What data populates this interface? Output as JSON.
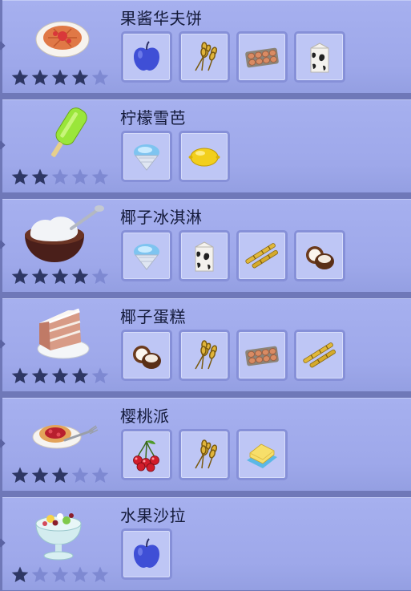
{
  "recipes": [
    {
      "name": "果酱华夫饼",
      "dish_icon": "jam-waffle-icon",
      "rating": 4,
      "max_rating": 5,
      "ingredients": [
        "apple",
        "wheat",
        "eggs",
        "milk"
      ]
    },
    {
      "name": "柠檬雪芭",
      "dish_icon": "lemon-sorbet-icon",
      "rating": 2,
      "max_rating": 5,
      "ingredients": [
        "ice",
        "lemon"
      ]
    },
    {
      "name": "椰子冰淇淋",
      "dish_icon": "coconut-ice-cream-icon",
      "rating": 4,
      "max_rating": 5,
      "ingredients": [
        "ice",
        "milk",
        "sugarcane",
        "coconut"
      ]
    },
    {
      "name": "椰子蛋糕",
      "dish_icon": "coconut-cake-icon",
      "rating": 4,
      "max_rating": 5,
      "ingredients": [
        "coconut",
        "wheat",
        "eggs",
        "sugarcane"
      ]
    },
    {
      "name": "樱桃派",
      "dish_icon": "cherry-pie-icon",
      "rating": 3,
      "max_rating": 5,
      "ingredients": [
        "cherry",
        "wheat",
        "butter"
      ]
    },
    {
      "name": "水果沙拉",
      "dish_icon": "fruit-salad-icon",
      "rating": 1,
      "max_rating": 5,
      "ingredients": [
        "apple"
      ]
    }
  ],
  "colors": {
    "panel": "#a3adee",
    "slot_background": "#bec6f5",
    "slot_border": "#8690d8",
    "star_filled": "#2e3764",
    "star_empty": "#7e89d2",
    "name_text": "#141a3a"
  }
}
